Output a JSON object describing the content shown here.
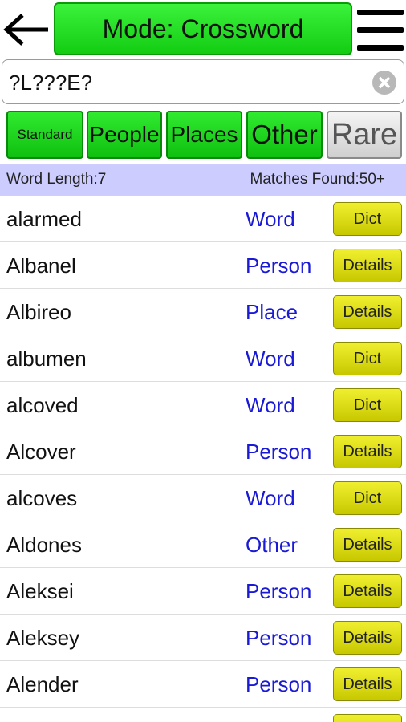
{
  "header": {
    "mode_label": "Mode: Crossword"
  },
  "search": {
    "value": "?L???E?"
  },
  "filters": [
    {
      "label": "Standard"
    },
    {
      "label": "People"
    },
    {
      "label": "Places"
    },
    {
      "label": "Other"
    },
    {
      "label": "Rare"
    }
  ],
  "info": {
    "word_length": "Word Length:7",
    "matches": "Matches Found:50+"
  },
  "results": [
    {
      "word": "alarmed",
      "type": "Word",
      "action": "Dict"
    },
    {
      "word": "Albanel",
      "type": "Person",
      "action": "Details"
    },
    {
      "word": "Albireo",
      "type": "Place",
      "action": "Details"
    },
    {
      "word": "albumen",
      "type": "Word",
      "action": "Dict"
    },
    {
      "word": "alcoved",
      "type": "Word",
      "action": "Dict"
    },
    {
      "word": "Alcover",
      "type": "Person",
      "action": "Details"
    },
    {
      "word": "alcoves",
      "type": "Word",
      "action": "Dict"
    },
    {
      "word": "Aldones",
      "type": "Other",
      "action": "Details"
    },
    {
      "word": "Aleksei",
      "type": "Person",
      "action": "Details"
    },
    {
      "word": "Aleksey",
      "type": "Person",
      "action": "Details"
    },
    {
      "word": "Alender",
      "type": "Person",
      "action": "Details"
    }
  ],
  "colors": {
    "green_button": "#22dd22",
    "yellow_button": "#dddd10",
    "info_bar": "#ccccff",
    "type_text": "#1a1ad6"
  },
  "icons": {
    "back": "back-arrow-icon",
    "menu": "hamburger-menu-icon",
    "clear": "clear-x-icon"
  }
}
